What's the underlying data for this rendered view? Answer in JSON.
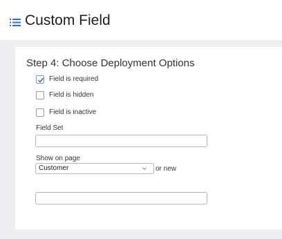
{
  "header": {
    "title": "Custom Field",
    "icon": "list-icon",
    "icon_color": "#2f72c4"
  },
  "step": {
    "title": "Step 4: Choose Deployment Options"
  },
  "checkboxes": [
    {
      "label": "Field is required",
      "checked": true
    },
    {
      "label": "Field is hidden",
      "checked": false
    },
    {
      "label": "Field is inactive",
      "checked": false
    }
  ],
  "field_set": {
    "label": "Field Set",
    "value": ""
  },
  "show_on_page": {
    "label": "Show on page",
    "selected": "Customer",
    "or_new_label": "or new",
    "new_value": ""
  },
  "colors": {
    "background": "#eceef1",
    "card": "#ffffff",
    "accent": "#2f72c4"
  }
}
